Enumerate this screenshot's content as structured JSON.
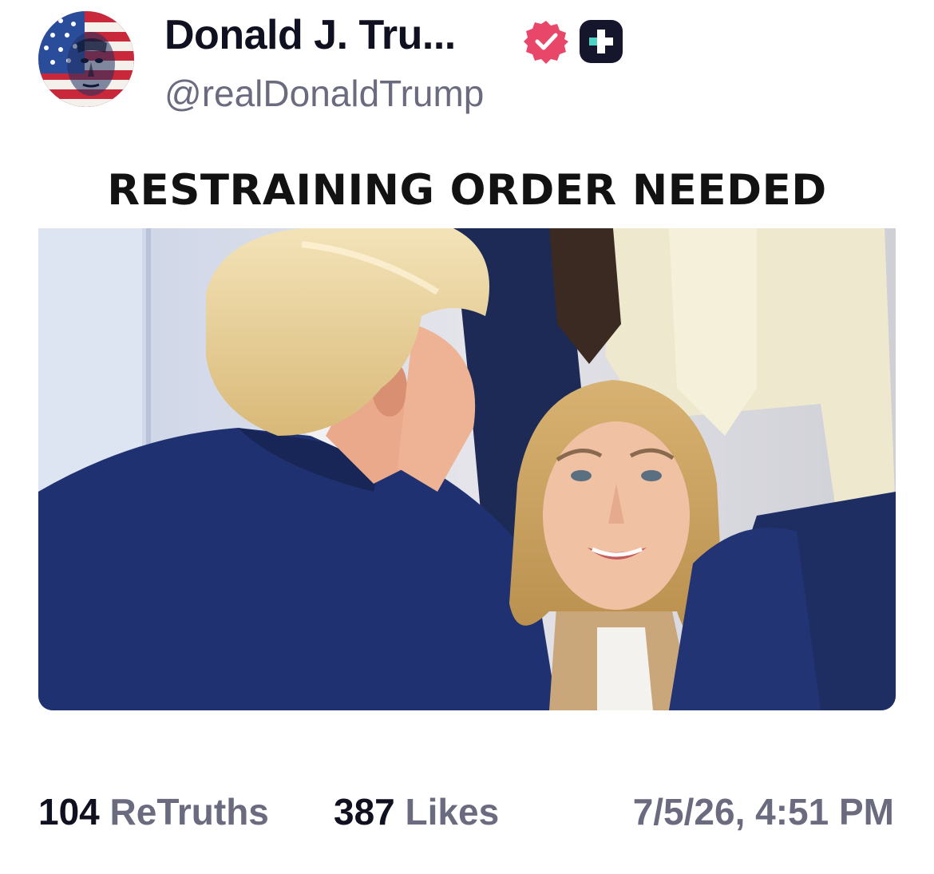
{
  "post": {
    "author": {
      "display_name": "Donald J. Tru...",
      "handle": "@realDonaldTrump",
      "avatar_icon": "flag-portrait-avatar",
      "verified_icon": "verified-badge-icon",
      "verified_color": "#e8476a",
      "plus_icon": "truth-plus-icon",
      "plus_color": "#15152b",
      "plus_accent": "#4fd1c5"
    },
    "media": {
      "caption": "RESTRAINING ORDER NEEDED",
      "image_icon": "photo-two-people"
    },
    "stats": {
      "retruths_count": "104",
      "retruths_label": "ReTruths",
      "likes_count": "387",
      "likes_label": "Likes"
    },
    "timestamp": "7/5/26, 4:51 PM"
  }
}
